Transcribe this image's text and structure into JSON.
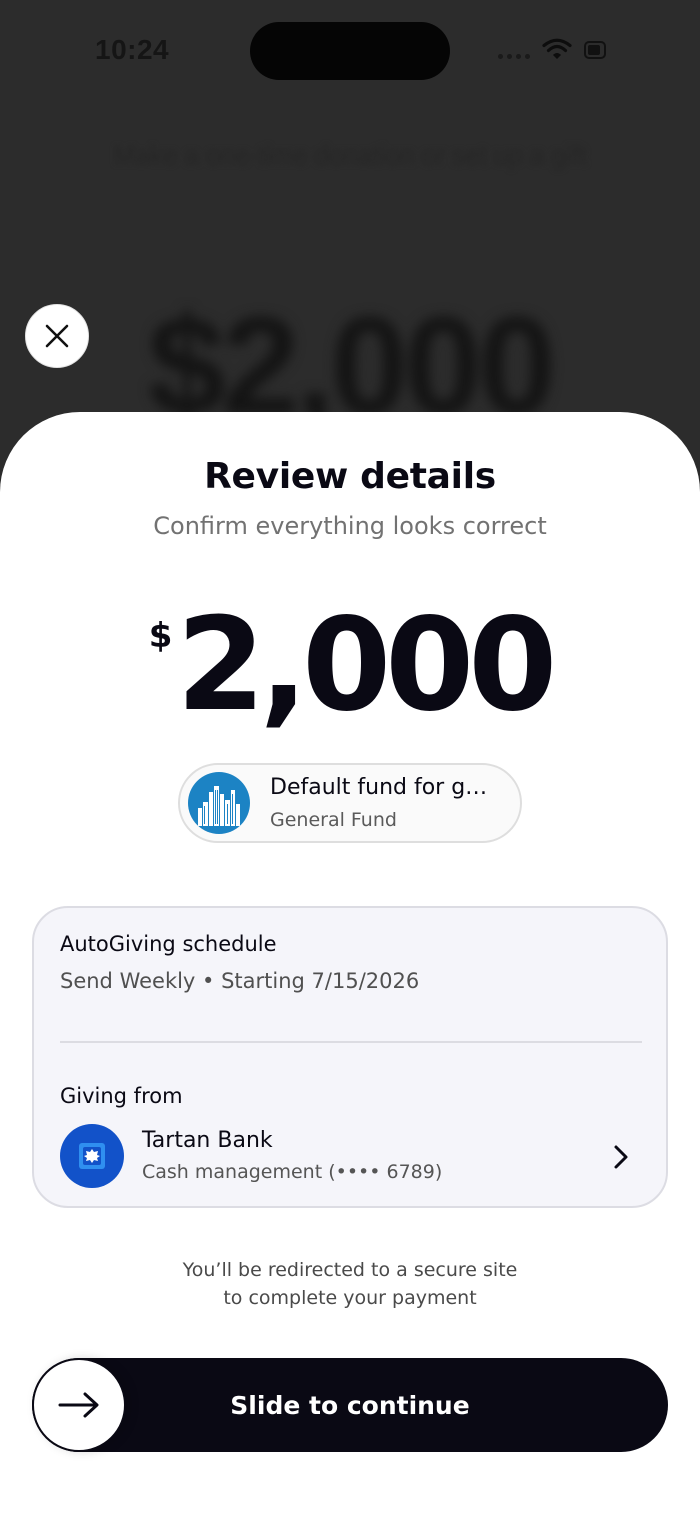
{
  "status_bar": {
    "time": "10:24"
  },
  "background": {
    "subtitle": "Make a one-time donation or set up a gift",
    "amount": "$2,000"
  },
  "sheet": {
    "title": "Review details",
    "subtitle": "Confirm everything looks correct",
    "amount": {
      "currency": "$",
      "value": "2,000"
    },
    "fund": {
      "name": "Default fund for g…",
      "subtitle": "General Fund",
      "avatar_icon": "city-skyline-icon"
    },
    "schedule": {
      "label": "AutoGiving schedule",
      "value": "Send Weekly • Starting 7/15/2026"
    },
    "source": {
      "label": "Giving from",
      "bank_name": "Tartan Bank",
      "account": "Cash management  (•••• 6789)",
      "logo_icon": "bank-logo-icon"
    },
    "redirect_note_line1": "You’ll be redirected to a secure site",
    "redirect_note_line2": "to complete your payment",
    "slide_label": "Slide to continue"
  },
  "colors": {
    "primary": "#0a0914",
    "fund_avatar": "#1c83c4",
    "bank_logo": "#1252c9",
    "card_bg": "#f5f5fa"
  }
}
